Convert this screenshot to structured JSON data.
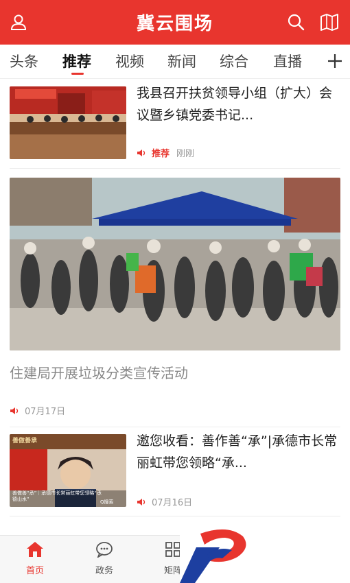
{
  "colors": {
    "brand": "#e8352e",
    "meta_gray": "#999999"
  },
  "header": {
    "title": "冀云围场",
    "left_icon": "user-icon",
    "right_icons": [
      "search-icon",
      "book-icon"
    ]
  },
  "tabs": {
    "items": [
      "头条",
      "推荐",
      "视频",
      "新闻",
      "综合",
      "直播"
    ],
    "active_index": 1,
    "add_icon": "plus-icon"
  },
  "articles": [
    {
      "title": "我县召开扶贫领导小组（扩大）会议暨乡镇党委书记...",
      "tag": "推荐",
      "time": "刚刚"
    },
    {
      "title": "住建局开展垃圾分类宣传活动",
      "time": "07月17日"
    },
    {
      "title": "邀您收看：善作善“承”|承德市长常丽虹带您领略“承...",
      "time": "07月16日",
      "thumb_caption": "善做善“承”｜承德市长常丽虹带您领略“承德山水”",
      "thumb_banner": "善做善承",
      "thumb_search": "Q搜索"
    }
  ],
  "bottom_nav": {
    "items": [
      {
        "label": "首页",
        "icon": "home-icon"
      },
      {
        "label": "政务",
        "icon": "chat-icon"
      },
      {
        "label": "矩阵",
        "icon": "grid-icon"
      }
    ],
    "active_index": 0
  }
}
